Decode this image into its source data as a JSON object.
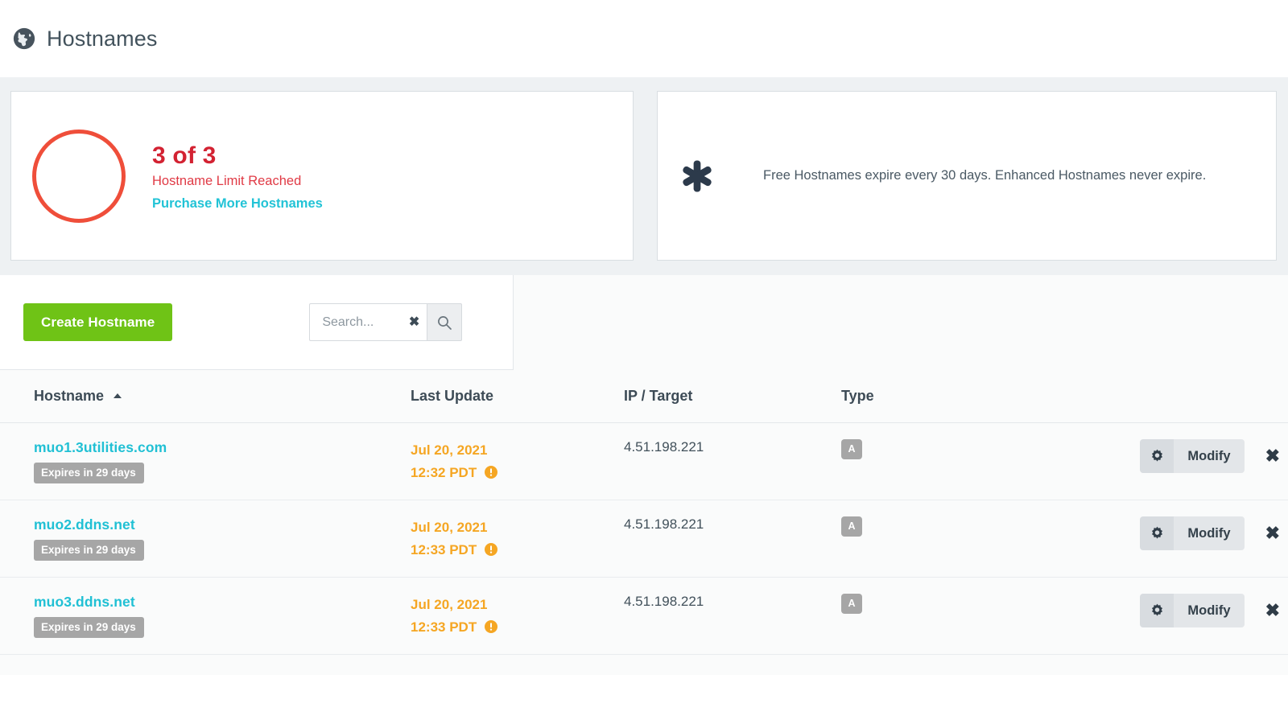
{
  "header": {
    "icon": "globe-icon",
    "title": "Hostnames"
  },
  "limit_card": {
    "count_label": "3 of 3",
    "status_label": "Hostname Limit Reached",
    "purchase_link": "Purchase More Hostnames",
    "ring_color": "#ef4e3a",
    "count_color": "#d32232",
    "status_color": "#e03a45",
    "link_color": "#22c3d6"
  },
  "note_card": {
    "icon": "asterisk-icon",
    "text": "Free Hostnames expire every 30 days. Enhanced Hostnames never expire."
  },
  "toolbar": {
    "create_label": "Create Hostname",
    "create_color": "#6fc316",
    "search_value": "",
    "search_placeholder": "Search...",
    "clear_icon": "close-icon",
    "clear_glyph": "✖",
    "search_icon": "search-icon"
  },
  "table": {
    "columns": [
      {
        "label": "Hostname",
        "sorted": "asc"
      },
      {
        "label": "Last Update",
        "sorted": ""
      },
      {
        "label": "IP / Target",
        "sorted": ""
      },
      {
        "label": "Type",
        "sorted": ""
      },
      {
        "label": "",
        "sorted": ""
      }
    ],
    "row_actions": {
      "modify_label": "Modify",
      "gear_icon": "gear-icon",
      "delete_icon": "close-icon",
      "delete_glyph": "✖"
    },
    "rows": [
      {
        "hostname": "muo1.3utilities.com",
        "expires": "Expires in 29 days",
        "update_date": "Jul 20, 2021",
        "update_time": "12:32 PDT",
        "update_warning_icon": "warning-icon",
        "ip": "4.51.198.221",
        "type": "A"
      },
      {
        "hostname": "muo2.ddns.net",
        "expires": "Expires in 29 days",
        "update_date": "Jul 20, 2021",
        "update_time": "12:33 PDT",
        "update_warning_icon": "warning-icon",
        "ip": "4.51.198.221",
        "type": "A"
      },
      {
        "hostname": "muo3.ddns.net",
        "expires": "Expires in 29 days",
        "update_date": "Jul 20, 2021",
        "update_time": "12:33 PDT",
        "update_warning_icon": "warning-icon",
        "ip": "4.51.198.221",
        "type": "A"
      }
    ]
  }
}
